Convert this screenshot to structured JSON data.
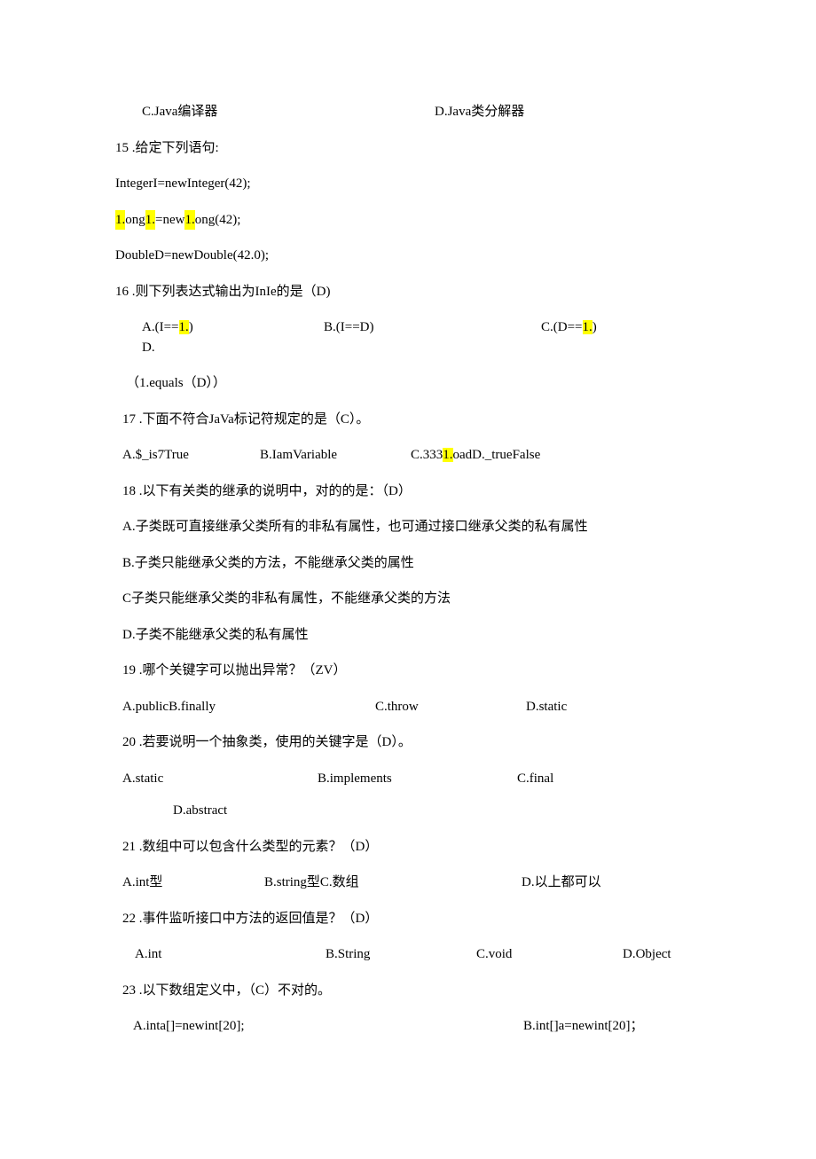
{
  "q14opts": {
    "c": "C.Java编译器",
    "d": "D.Java类分解器"
  },
  "q15": {
    "stem": "15 .给定下列语句:",
    "l1a": "IntegerI=newInteger(42);",
    "l2_p1": "1.",
    "l2_p2": "ong",
    "l2_p3": "1.",
    "l2_p4": "=new",
    "l2_p5": "1.",
    "l2_p6": "ong(42);",
    "l3": "DoubleD=newDouble(42.0);"
  },
  "q16": {
    "stem": "16 .则下列表达式输出为InIe的是（D)",
    "a": "A.(I==",
    "a_hl": "1.",
    "a_end": ")",
    "b": "B.(I==D)",
    "c": "C.(D==",
    "c_hl": "1.",
    "c_end": ")",
    "d": "D.",
    "cont": "（1.equals（D））"
  },
  "q17": {
    "stem": "17 .下面不符合JaVa标记符规定的是（C）。",
    "a": "A.$_is7True",
    "b": "B.IamVariable",
    "c_p1": "C.333",
    "c_hl": "1.",
    "c_p2": "oadD._trueFalse"
  },
  "q18": {
    "stem": "18 .以下有关类的继承的说明中，对的的是：（D）",
    "a": "A.子类既可直接继承父类所有的非私有属性，也可通过接口继承父类的私有属性",
    "b": "B.子类只能继承父类的方法，不能继承父类的属性",
    "c": "C子类只能继承父类的非私有属性，不能继承父类的方法",
    "d": "D.子类不能继承父类的私有属性"
  },
  "q19": {
    "stem": "19 .哪个关键字可以抛出异常？（ZV）",
    "a": "A.publicB.finally",
    "c": "C.throw",
    "d": "D.static"
  },
  "q20": {
    "stem": "20 .若要说明一个抽象类，使用的关键字是（D）。",
    "a": "A.static",
    "b": "B.implements",
    "c": "C.final",
    "d": "D.abstract"
  },
  "q21": {
    "stem": "21 .数组中可以包含什么类型的元素？（D）",
    "a": "A.int型",
    "b": "B.string型C.数组",
    "d": "D.以上都可以"
  },
  "q22": {
    "stem": "22 .事件监听接口中方法的返回值是？（D）",
    "a": "A.int",
    "b": "B.String",
    "c": "C.void",
    "d": "D.Object"
  },
  "q23": {
    "stem": "23 .以下数组定义中，（C）不对的。",
    "a": "A.inta[]=newint[20];",
    "b": "B.int[]a=newint[20]；"
  }
}
